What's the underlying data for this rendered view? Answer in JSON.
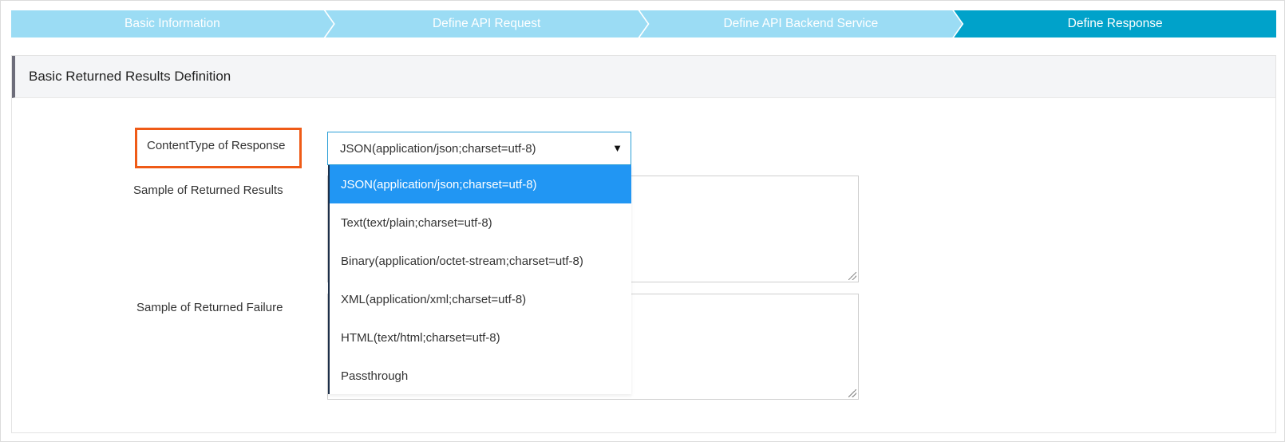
{
  "steps": [
    {
      "label": "Basic Information",
      "active": false
    },
    {
      "label": "Define API Request",
      "active": false
    },
    {
      "label": "Define API Backend Service",
      "active": false
    },
    {
      "label": "Define Response",
      "active": true
    }
  ],
  "section": {
    "title": "Basic Returned Results Definition"
  },
  "form": {
    "content_type_label": "ContentType of Response",
    "sample_results_label": "Sample of Returned Results",
    "sample_failure_label": "Sample of Returned Failure",
    "selected_value": "JSON(application/json;charset=utf-8)",
    "arrow_glyph": "▼"
  },
  "dropdown": {
    "options": [
      {
        "label": "JSON(application/json;charset=utf-8)",
        "selected": true
      },
      {
        "label": "Text(text/plain;charset=utf-8)",
        "selected": false
      },
      {
        "label": "Binary(application/octet-stream;charset=utf-8)",
        "selected": false
      },
      {
        "label": "XML(application/xml;charset=utf-8)",
        "selected": false
      },
      {
        "label": "HTML(text/html;charset=utf-8)",
        "selected": false
      },
      {
        "label": "Passthrough",
        "selected": false
      }
    ]
  },
  "colors": {
    "step_inactive": "#9bdcf4",
    "step_active": "#00a2ca",
    "highlight": "#ef5b17",
    "dropdown_selected": "#2196f3",
    "select_border": "#2b9fd6"
  }
}
